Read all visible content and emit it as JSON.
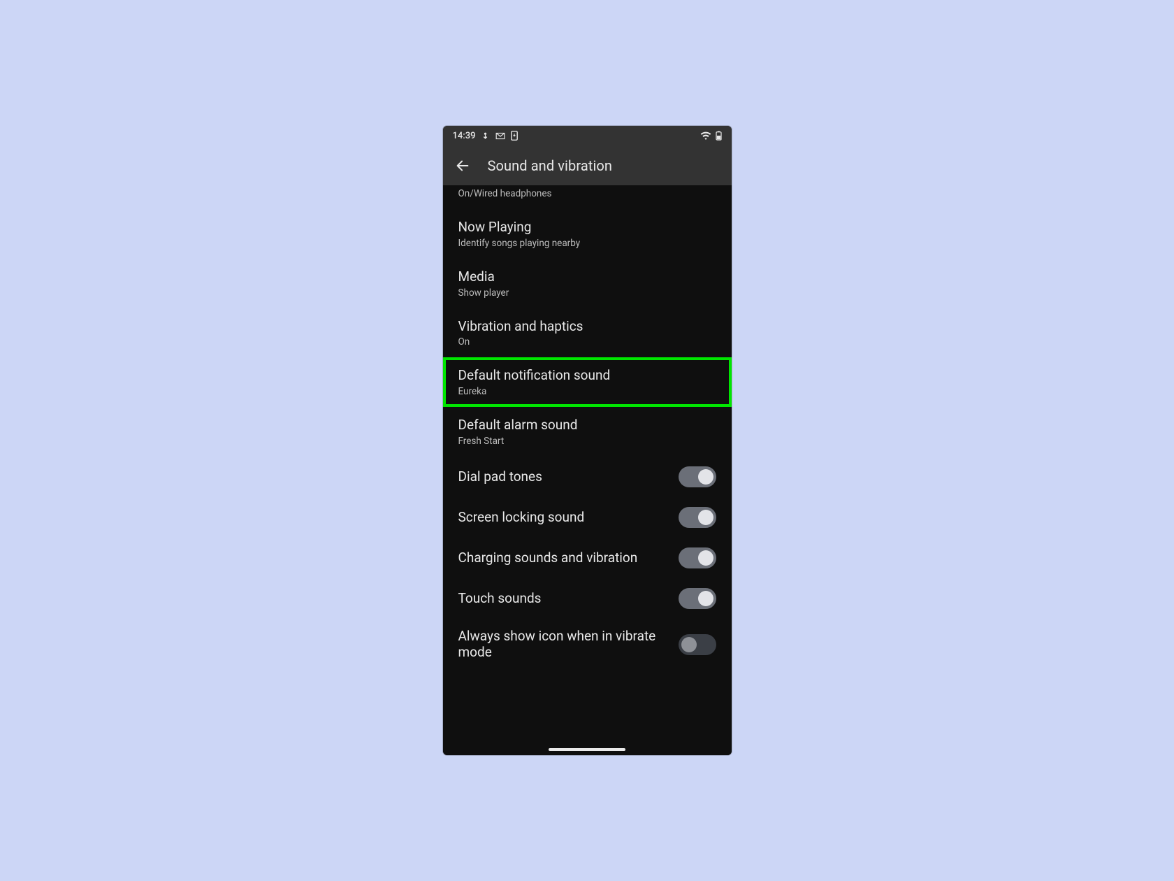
{
  "statusbar": {
    "time": "14:39"
  },
  "appbar": {
    "title": "Sound and vibration"
  },
  "rows": {
    "partial_sub": "On/Wired headphones",
    "now_playing": {
      "title": "Now Playing",
      "sub": "Identify songs playing nearby"
    },
    "media": {
      "title": "Media",
      "sub": "Show player"
    },
    "vibration": {
      "title": "Vibration and haptics",
      "sub": "On"
    },
    "notif_sound": {
      "title": "Default notification sound",
      "sub": "Eureka"
    },
    "alarm_sound": {
      "title": "Default alarm sound",
      "sub": "Fresh Start"
    },
    "dial_pad": {
      "title": "Dial pad tones",
      "on": true
    },
    "screen_lock": {
      "title": "Screen locking sound",
      "on": true
    },
    "charging": {
      "title": "Charging sounds and vibration",
      "on": true
    },
    "touch": {
      "title": "Touch sounds",
      "on": true
    },
    "vibrate_icon": {
      "title": "Always show icon when in vibrate mode",
      "on": false
    }
  }
}
